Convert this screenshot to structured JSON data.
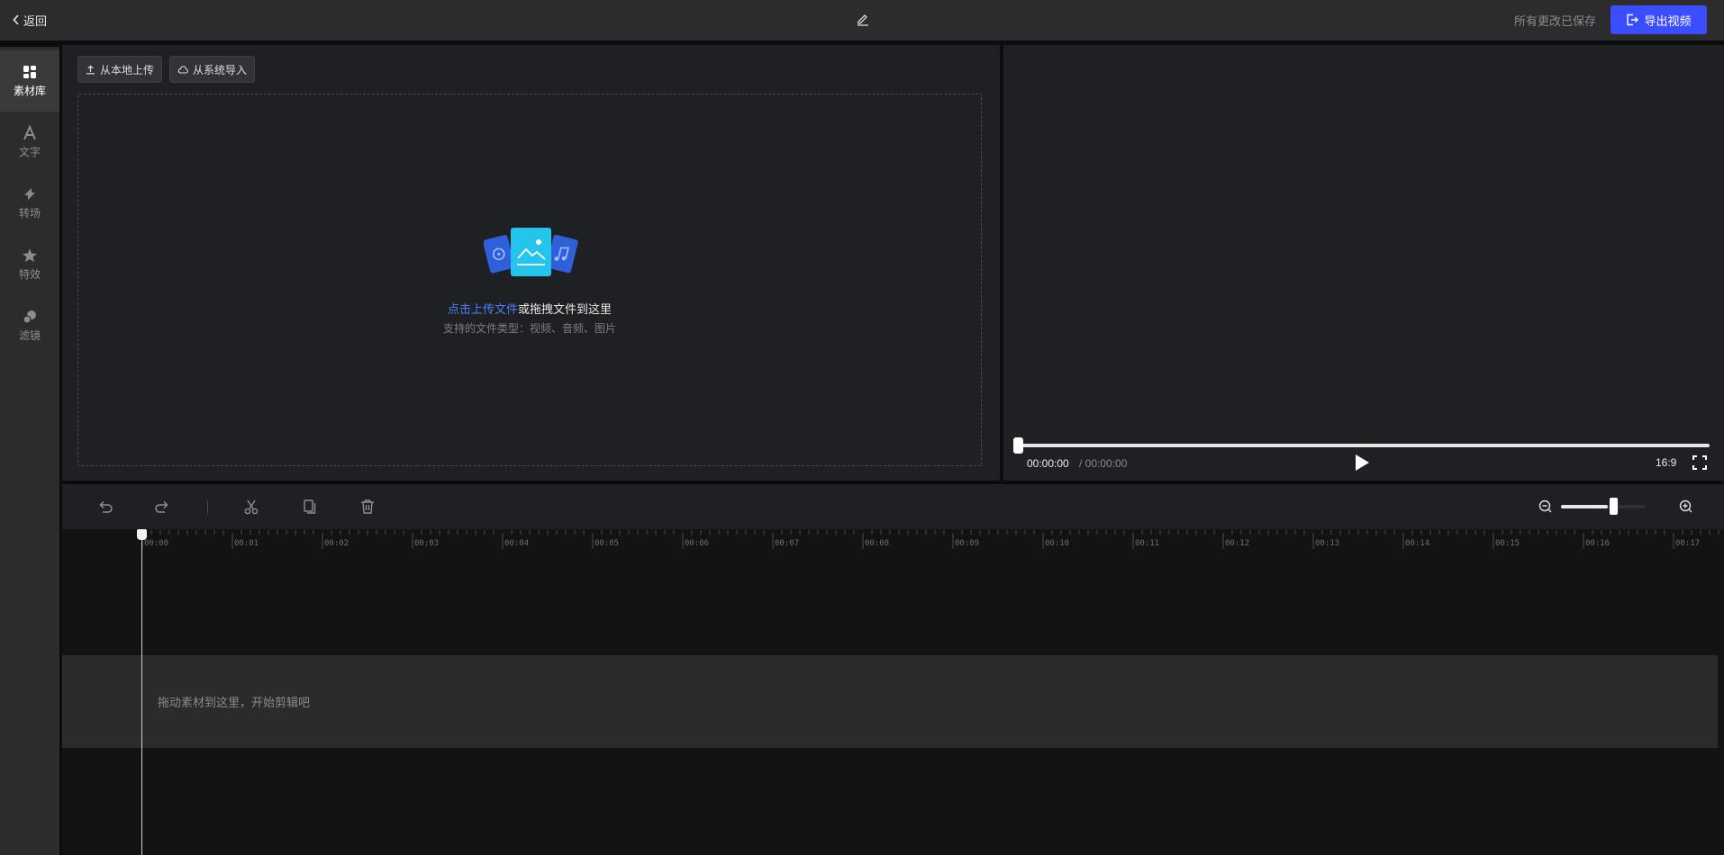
{
  "topbar": {
    "back_label": "返回",
    "saved_status": "所有更改已保存",
    "export_label": "导出视频"
  },
  "sidebar": {
    "items": [
      {
        "label": "素材库",
        "icon": "grid-icon",
        "active": true
      },
      {
        "label": "文字",
        "icon": "text-icon",
        "active": false
      },
      {
        "label": "转场",
        "icon": "transition-icon",
        "active": false
      },
      {
        "label": "特效",
        "icon": "effects-star-icon",
        "active": false
      },
      {
        "label": "滤镜",
        "icon": "filter-icon",
        "active": false
      }
    ]
  },
  "material": {
    "upload_local": "从本地上传",
    "import_system": "从系统导入",
    "drop_link": "点击上传文件",
    "drop_text": "或拖拽文件到这里",
    "drop_sub": "支持的文件类型：视频、音频、图片"
  },
  "preview": {
    "current_time": "00:00:00",
    "total_time": "/ 00:00:00",
    "aspect_ratio": "16:9",
    "progress": 0
  },
  "timeline": {
    "ruler_labels": [
      "00:00",
      "00:01",
      "00:02",
      "00:03",
      "00:04",
      "00:05",
      "00:06",
      "00:07",
      "00:08",
      "00:09",
      "00:10",
      "00:11",
      "00:12",
      "00:13",
      "00:14",
      "00:15",
      "00:16",
      "00:17"
    ],
    "track_hint": "拖动素材到这里，开始剪辑吧",
    "zoom_level": 0.55
  },
  "colors": {
    "accent": "#3a4dff",
    "link": "#4a7dff"
  }
}
